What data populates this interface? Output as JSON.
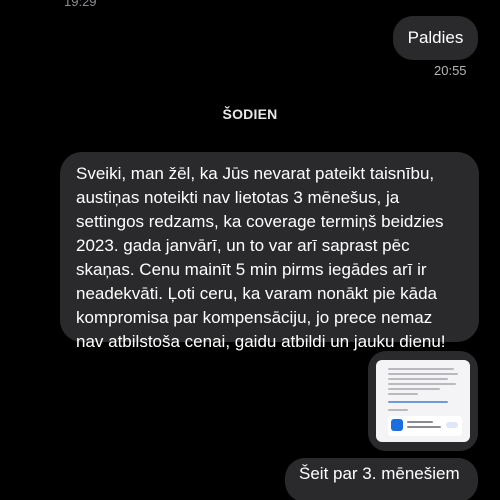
{
  "header": {
    "previous_time": "19:29"
  },
  "messages": {
    "thanks": {
      "text": "Paldies",
      "time": "20:55"
    },
    "day_separator": "ŠODIEN",
    "long_message": {
      "lines": [
        "Sveiki, man žēl, ka Jūs nevarat pateikt taisnību,",
        "austiņas noteikti nav lietotas 3 mēnešus, ja",
        "settingos redzams, ka coverage termiņš beidzies",
        "2023. gada janvārī, un to var arī saprast pēc",
        "skaņas. Cenu mainīt 5 min pirms iegādes arī ir",
        "neadekvāti. Ļoti ceru, ka varam nonākt pie kāda",
        "kompromisa par kompensāciju, jo prece nemaz",
        "nav atbilstoša cenai, gaidu atbildi un jauku dienu!"
      ]
    },
    "image_attachment": {
      "icon": "screenshot-thumbnail-icon"
    },
    "third": {
      "text": "Šeit par 3. mēnešiem"
    }
  },
  "colors": {
    "background": "#000000",
    "bubble": "#2a2a2c",
    "timestamp": "#b5b5b8"
  }
}
